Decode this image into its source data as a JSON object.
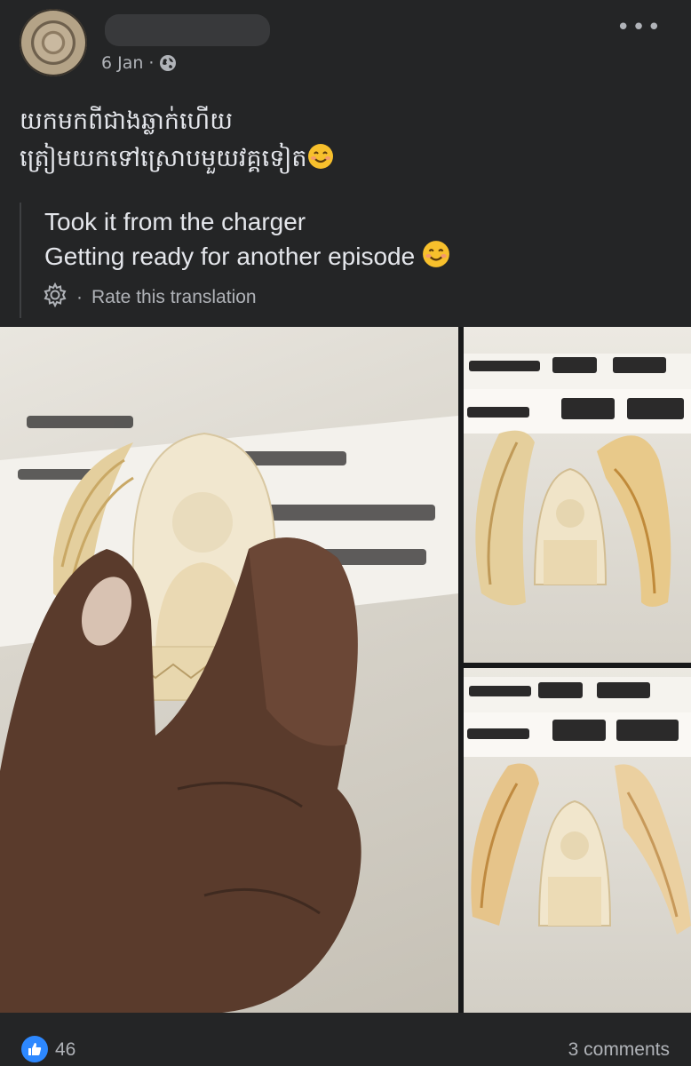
{
  "post": {
    "date": "6 Jan",
    "separator": "·",
    "privacy_icon": "globe-icon",
    "menu_icon": "more-icon",
    "more_glyph": "•••",
    "text_line1": "យកមកពីជាងឆ្លាក់ហើយ",
    "text_line2": "ត្រៀមយកទៅស្រោបមួយវគ្គទៀត"
  },
  "translation": {
    "line1": "Took it from the charger",
    "line2": "Getting ready for another episode",
    "rate_label": "Rate this translation",
    "rate_separator": "·"
  },
  "reactions": {
    "like_count": "46",
    "comments": "3 comments"
  },
  "colors": {
    "background": "#242526",
    "text": "#e4e6eb",
    "muted": "#b0b3b8",
    "like_blue": "#2d88ff"
  }
}
